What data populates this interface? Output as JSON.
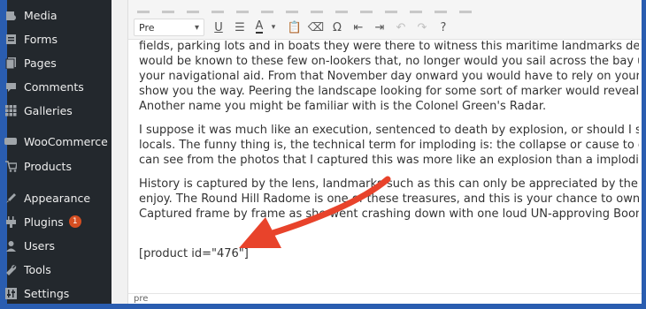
{
  "sidebar": {
    "items": [
      {
        "label": "Media",
        "icon": "media-icon"
      },
      {
        "label": "Forms",
        "icon": "forms-icon"
      },
      {
        "label": "Pages",
        "icon": "pages-icon"
      },
      {
        "label": "Comments",
        "icon": "comments-icon"
      },
      {
        "label": "Galleries",
        "icon": "galleries-icon"
      },
      {
        "label": "WooCommerce",
        "icon": "woocommerce-icon"
      },
      {
        "label": "Products",
        "icon": "products-icon"
      },
      {
        "label": "Appearance",
        "icon": "appearance-icon"
      },
      {
        "label": "Plugins",
        "icon": "plugins-icon",
        "badge": "1"
      },
      {
        "label": "Users",
        "icon": "users-icon"
      },
      {
        "label": "Tools",
        "icon": "tools-icon"
      },
      {
        "label": "Settings",
        "icon": "settings-icon"
      }
    ]
  },
  "toolbar": {
    "format_value": "Pre"
  },
  "content": {
    "lines_p1": [
      "fields, parking lots and in boats they were there to witness this maritime landmarks demise. A",
      "would be known to these few on-lookers that, no longer would you sail across the bay using th",
      "your navigational aid. From that November day onward you would have to rely on your compa",
      "show you the way. Peering the landscape looking for some sort of marker would reveal little no",
      "Another name you might be familiar with is the Colonel Green's Radar."
    ],
    "lines_p2": [
      "I suppose it was much like an execution, sentenced to death by explosion, or should I say implo",
      "locals. The funny thing is, the technical term for imploding is: the collapse or cause to collapse",
      "can see from the photos that I captured this was more like an explosion than a imploding."
    ],
    "lines_p3": [
      "History is captured by the lens, landmarks such as this can only be appreciated by the photos",
      "enjoy. The Round Hill Radome is one of these treasures, and this is your chance to own one of",
      "Captured frame by frame as she went crashing down with one loud UN-approving Boom!"
    ],
    "shortcode": "[product id=\"476\"]"
  },
  "status_bar": "pre",
  "colors": {
    "frame": "#2a5db0",
    "sidebar": "#23282d",
    "arrow": "#e8432b",
    "badge": "#d54e21"
  }
}
